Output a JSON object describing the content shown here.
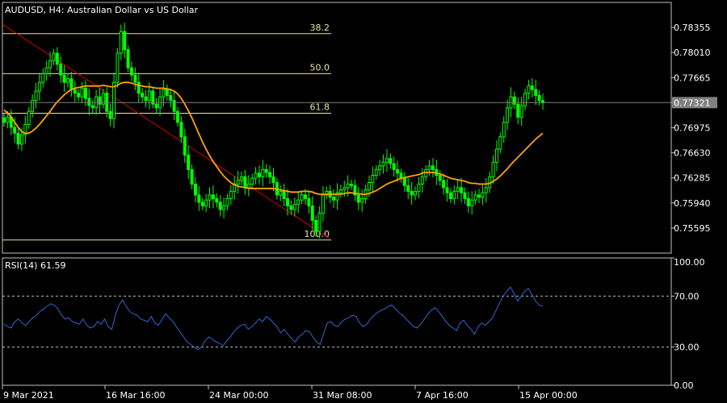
{
  "chart_data": [
    {
      "type": "candlestick",
      "title": "AUDUSD, H4:  Australian Dollar vs US Dollar",
      "ylim": [
        0.7525,
        0.787
      ],
      "y_ticks": [
        "0.78355",
        "0.78010",
        "0.77665",
        "0.77320",
        "0.76975",
        "0.76630",
        "0.76285",
        "0.75940",
        "0.75595"
      ],
      "x_ticks": [
        "9 Mar 2021",
        "16 Mar 16:00",
        "24 Mar 00:00",
        "31 Mar 08:00",
        "7 Apr 16:00",
        "15 Apr 00:00"
      ],
      "current_price": "0.77321",
      "colors": {
        "candles": "#00FF00",
        "moving_average": "#FFA500",
        "trendline": "#CC0000",
        "fibonacci": "#E6E699",
        "price_line": "#808080"
      },
      "fibonacci_levels": [
        {
          "label": "38.2",
          "price": 0.7827
        },
        {
          "label": "50.0",
          "price": 0.7772
        },
        {
          "label": "61.8",
          "price": 0.77175
        },
        {
          "label": "100.0",
          "price": 0.7543
        }
      ],
      "trendline": {
        "start": {
          "date": "9 Mar 2021",
          "price": 0.784
        },
        "end": {
          "date": "1 Apr 2021",
          "price": 0.7545
        }
      },
      "candles_close": [
        0.7705,
        0.7712,
        0.7698,
        0.769,
        0.7675,
        0.7688,
        0.7702,
        0.772,
        0.7735,
        0.7748,
        0.776,
        0.7772,
        0.778,
        0.779,
        0.78,
        0.7785,
        0.777,
        0.776,
        0.7765,
        0.775,
        0.7745,
        0.774,
        0.7752,
        0.7738,
        0.7728,
        0.7725,
        0.774,
        0.773,
        0.7745,
        0.772,
        0.771,
        0.776,
        0.78,
        0.783,
        0.7805,
        0.778,
        0.777,
        0.776,
        0.7745,
        0.774,
        0.7735,
        0.7748,
        0.773,
        0.7725,
        0.774,
        0.775,
        0.7742,
        0.7735,
        0.772,
        0.7705,
        0.7685,
        0.766,
        0.764,
        0.762,
        0.7605,
        0.7595,
        0.759,
        0.7598,
        0.7605,
        0.76,
        0.7595,
        0.7585,
        0.759,
        0.76,
        0.761,
        0.762,
        0.7625,
        0.763,
        0.7615,
        0.762,
        0.7628,
        0.7635,
        0.763,
        0.764,
        0.7636,
        0.763,
        0.7622,
        0.7605,
        0.761,
        0.76,
        0.759,
        0.7585,
        0.7592,
        0.7598,
        0.7605,
        0.76,
        0.759,
        0.757,
        0.7555,
        0.758,
        0.7605,
        0.761,
        0.7602,
        0.7598,
        0.7608,
        0.7612,
        0.7615,
        0.762,
        0.7618,
        0.7605,
        0.7595,
        0.76,
        0.7612,
        0.7622,
        0.7632,
        0.764,
        0.7645,
        0.765,
        0.7655,
        0.7648,
        0.764,
        0.7635,
        0.7628,
        0.7618,
        0.761,
        0.7605,
        0.761,
        0.762,
        0.763,
        0.764,
        0.7645,
        0.764,
        0.7632,
        0.7625,
        0.7615,
        0.7608,
        0.76,
        0.761,
        0.7615,
        0.7608,
        0.76,
        0.759,
        0.7598,
        0.7605,
        0.7602,
        0.7608,
        0.7615,
        0.763,
        0.765,
        0.7668,
        0.7685,
        0.7705,
        0.7725,
        0.774,
        0.773,
        0.7712,
        0.7728,
        0.7745,
        0.7755,
        0.775,
        0.7742,
        0.7735,
        0.7732
      ],
      "moving_average": [
        0.7722,
        0.7718,
        0.7712,
        0.7705,
        0.7698,
        0.7692,
        0.769,
        0.769,
        0.7693,
        0.7697,
        0.7702,
        0.7708,
        0.7714,
        0.772,
        0.7727,
        0.7733,
        0.7738,
        0.7743,
        0.7747,
        0.775,
        0.7752,
        0.7753,
        0.7754,
        0.7755,
        0.7755,
        0.7755,
        0.7755,
        0.7755,
        0.7756,
        0.7755,
        0.7754,
        0.7754,
        0.7756,
        0.7759,
        0.776,
        0.776,
        0.7759,
        0.7757,
        0.7756,
        0.7755,
        0.7754,
        0.7754,
        0.7753,
        0.7752,
        0.7752,
        0.7752,
        0.7751,
        0.775,
        0.7748,
        0.7744,
        0.7738,
        0.773,
        0.7721,
        0.7711,
        0.77,
        0.7689,
        0.7678,
        0.7668,
        0.7659,
        0.7651,
        0.7644,
        0.7637,
        0.7631,
        0.7626,
        0.7622,
        0.7619,
        0.7617,
        0.7616,
        0.7615,
        0.7614,
        0.7614,
        0.7614,
        0.7614,
        0.7614,
        0.7614,
        0.7614,
        0.7614,
        0.7613,
        0.7612,
        0.7611,
        0.761,
        0.7609,
        0.7609,
        0.7609,
        0.761,
        0.761,
        0.761,
        0.7609,
        0.7607,
        0.7606,
        0.7606,
        0.7606,
        0.7606,
        0.7606,
        0.7606,
        0.7606,
        0.7607,
        0.7608,
        0.7608,
        0.7607,
        0.7607,
        0.7606,
        0.7606,
        0.7607,
        0.7609,
        0.7611,
        0.7614,
        0.7617,
        0.762,
        0.7622,
        0.7624,
        0.7626,
        0.7628,
        0.7629,
        0.763,
        0.7631,
        0.7632,
        0.7633,
        0.7635,
        0.7636,
        0.7636,
        0.7636,
        0.7635,
        0.7634,
        0.7632,
        0.763,
        0.7628,
        0.7627,
        0.7626,
        0.7625,
        0.7624,
        0.7622,
        0.7621,
        0.7621,
        0.762,
        0.762,
        0.762,
        0.7621,
        0.7624,
        0.7627,
        0.7631,
        0.7636,
        0.7641,
        0.7647,
        0.7652,
        0.7657,
        0.7662,
        0.7667,
        0.7672,
        0.7677,
        0.7682,
        0.7686,
        0.769
      ]
    },
    {
      "type": "line",
      "title": "RSI(14) 61.59",
      "ylim": [
        0,
        100
      ],
      "y_ticks": [
        "100.00",
        "70.00",
        "30.00",
        "0.00"
      ],
      "levels": [
        70,
        30
      ],
      "colors": {
        "line": "#3366CC",
        "level": "#BBBBBB"
      },
      "values": [
        48,
        46,
        45,
        50,
        52,
        49,
        47,
        50,
        53,
        55,
        58,
        60,
        62,
        64,
        63,
        60,
        55,
        52,
        53,
        50,
        49,
        48,
        52,
        47,
        45,
        46,
        50,
        48,
        52,
        46,
        44,
        55,
        63,
        67,
        62,
        58,
        56,
        55,
        52,
        51,
        50,
        54,
        49,
        47,
        52,
        56,
        53,
        50,
        46,
        42,
        38,
        34,
        32,
        30,
        28,
        30,
        35,
        38,
        36,
        34,
        33,
        31,
        35,
        38,
        42,
        45,
        47,
        48,
        44,
        46,
        49,
        52,
        50,
        54,
        52,
        49,
        46,
        41,
        44,
        40,
        37,
        34,
        38,
        40,
        43,
        42,
        38,
        34,
        32,
        41,
        49,
        50,
        47,
        46,
        50,
        52,
        53,
        55,
        54,
        49,
        46,
        48,
        52,
        55,
        57,
        59,
        60,
        62,
        63,
        60,
        57,
        55,
        52,
        49,
        46,
        45,
        48,
        52,
        56,
        59,
        61,
        58,
        54,
        50,
        47,
        45,
        43,
        49,
        51,
        47,
        44,
        40,
        46,
        49,
        47,
        50,
        53,
        59,
        65,
        70,
        74,
        77,
        72,
        66,
        70,
        74,
        76,
        71,
        66,
        63,
        62
      ]
    }
  ]
}
